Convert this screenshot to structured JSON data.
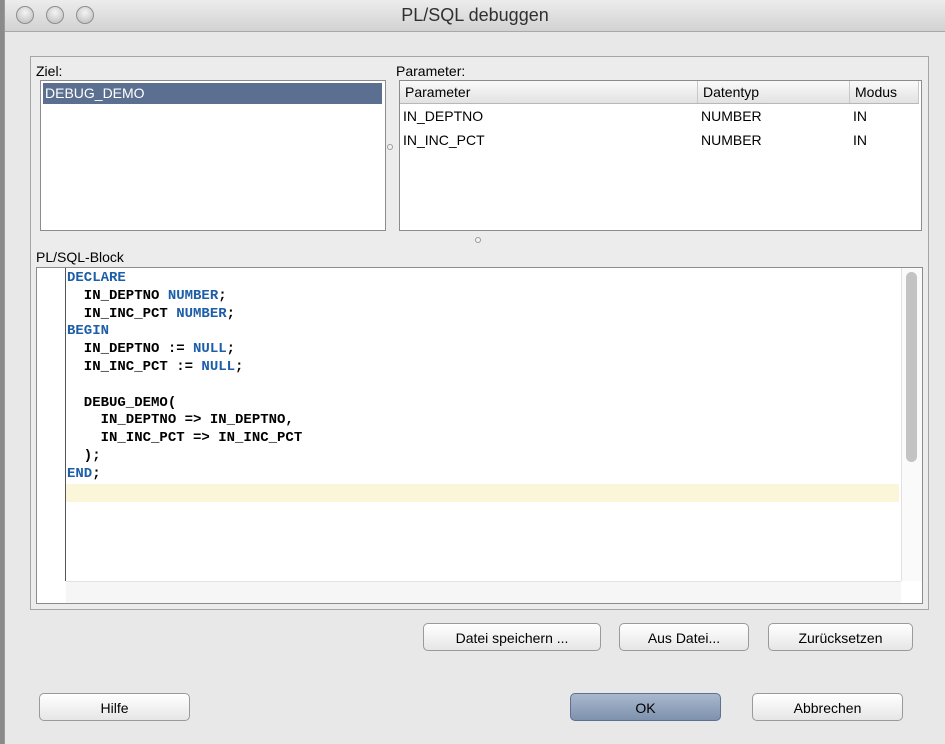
{
  "window": {
    "title": "PL/SQL debuggen"
  },
  "ziel": {
    "label": "Ziel:",
    "items": [
      "DEBUG_DEMO"
    ]
  },
  "parameter": {
    "label": "Parameter:",
    "columns": [
      "Parameter",
      "Datentyp",
      "Modus"
    ],
    "rows": [
      [
        "IN_DEPTNO",
        "NUMBER",
        "IN"
      ],
      [
        "IN_INC_PCT",
        "NUMBER",
        "IN"
      ]
    ]
  },
  "plsql": {
    "label": "PL/SQL-Block",
    "lines": [
      [
        {
          "t": "DECLARE",
          "kw": true
        }
      ],
      [
        {
          "t": "  IN_DEPTNO "
        },
        {
          "t": "NUMBER",
          "kw": true
        },
        {
          "t": ";"
        }
      ],
      [
        {
          "t": "  IN_INC_PCT "
        },
        {
          "t": "NUMBER",
          "kw": true
        },
        {
          "t": ";"
        }
      ],
      [
        {
          "t": "BEGIN",
          "kw": true
        }
      ],
      [
        {
          "t": "  IN_DEPTNO := "
        },
        {
          "t": "NULL",
          "kw": true
        },
        {
          "t": ";"
        }
      ],
      [
        {
          "t": "  IN_INC_PCT := "
        },
        {
          "t": "NULL",
          "kw": true
        },
        {
          "t": ";"
        }
      ],
      [
        {
          "t": ""
        }
      ],
      [
        {
          "t": "  DEBUG_DEMO("
        }
      ],
      [
        {
          "t": "    IN_DEPTNO => IN_DEPTNO,"
        }
      ],
      [
        {
          "t": "    IN_INC_PCT => IN_INC_PCT"
        }
      ],
      [
        {
          "t": "  );"
        }
      ],
      [
        {
          "t": "END",
          "kw": true
        },
        {
          "t": ";"
        }
      ],
      [
        {
          "t": ""
        }
      ]
    ],
    "keyword_color": "#1d5ea8",
    "current_line_color": "#fbf6d9"
  },
  "buttons": {
    "save_file": "Datei speichern ...",
    "from_file": "Aus Datei...",
    "reset": "Zurücksetzen",
    "help": "Hilfe",
    "ok": "OK",
    "cancel": "Abbrechen"
  }
}
